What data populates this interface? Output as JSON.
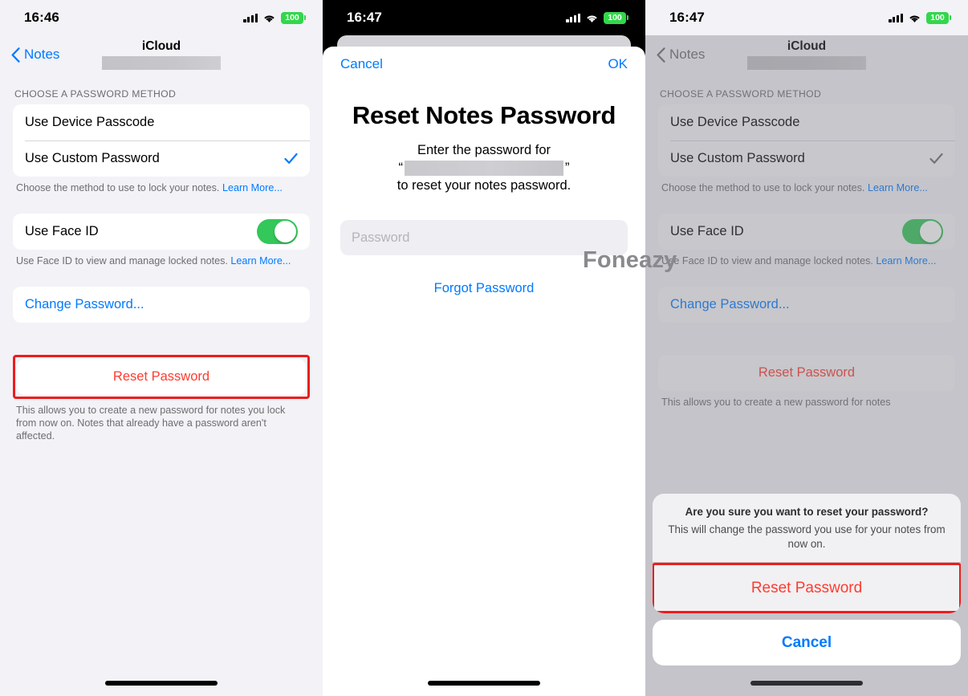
{
  "panels": {
    "left": {
      "status": {
        "time": "16:46",
        "battery": "100",
        "signal_icon": "cellular-bars-icon",
        "wifi_icon": "wifi-icon",
        "battery_icon": "battery-icon"
      },
      "nav": {
        "back_label": "Notes",
        "back_icon": "chevron-left-icon",
        "title": "iCloud",
        "account_redacted": true
      },
      "group_header": "CHOOSE A PASSWORD METHOD",
      "method_rows": [
        {
          "label": "Use Device Passcode",
          "selected": false
        },
        {
          "label": "Use Custom Password",
          "selected": true,
          "check_icon": "checkmark-icon"
        }
      ],
      "method_footnote": "Choose the method to use to lock your notes. ",
      "method_footnote_link": "Learn More...",
      "faceid_row": {
        "label": "Use Face ID",
        "toggle_on": true,
        "toggle_color": "#34c759"
      },
      "faceid_footnote": "Use Face ID to view and manage locked notes. ",
      "faceid_footnote_link": "Learn More...",
      "change_password_label": "Change Password...",
      "reset_password_label": "Reset Password",
      "reset_footnote": "This allows you to create a new password for notes you lock from now on. Notes that already have a password aren't affected.",
      "highlight_color": "#ee1c1c"
    },
    "middle": {
      "status": {
        "time": "16:47",
        "battery": "100",
        "signal_icon": "cellular-bars-icon",
        "wifi_icon": "wifi-icon",
        "battery_icon": "battery-icon"
      },
      "sheet": {
        "cancel_label": "Cancel",
        "ok_label": "OK",
        "title": "Reset Notes Password",
        "subtitle_line1": "Enter the password for",
        "quote_open": "“",
        "quote_close": "”",
        "account_redacted": true,
        "subtitle_line3": "to reset your notes password.",
        "password_placeholder": "Password",
        "password_value": "",
        "forgot_label": "Forgot Password"
      }
    },
    "right": {
      "status": {
        "time": "16:47",
        "battery": "100",
        "signal_icon": "cellular-bars-icon",
        "wifi_icon": "wifi-icon",
        "battery_icon": "battery-icon"
      },
      "nav": {
        "back_label": "Notes",
        "back_icon": "chevron-left-icon",
        "title": "iCloud",
        "account_redacted": true
      },
      "group_header": "CHOOSE A PASSWORD METHOD",
      "method_rows": [
        {
          "label": "Use Device Passcode",
          "selected": false
        },
        {
          "label": "Use Custom Password",
          "selected": true,
          "check_icon": "checkmark-icon"
        }
      ],
      "method_footnote": "Choose the method to use to lock your notes. ",
      "method_footnote_link": "Learn More...",
      "faceid_row": {
        "label": "Use Face ID",
        "toggle_on": true,
        "toggle_color": "#34c759"
      },
      "faceid_footnote": "Use Face ID to view and manage locked notes. ",
      "faceid_footnote_link": "Learn More...",
      "change_password_label": "Change Password...",
      "reset_password_label": "Reset Password",
      "reset_footnote": "This allows you to create a new password for notes",
      "alert": {
        "title": "Are you sure you want to reset your password?",
        "message": "This will change the password you use for your notes from now on.",
        "destructive_label": "Reset Password",
        "cancel_label": "Cancel",
        "highlight_color": "#ee1c1c"
      }
    }
  },
  "watermark": {
    "text": "Foneazy",
    "color": "#8a8a8e"
  }
}
